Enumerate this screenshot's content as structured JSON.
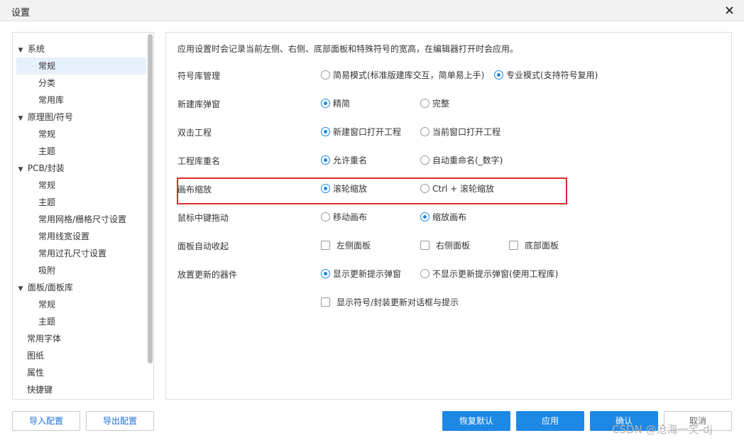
{
  "window": {
    "title": "设置"
  },
  "tree": {
    "items": [
      {
        "label": "系统",
        "expanded": true
      },
      {
        "label": "常规",
        "selected": true
      },
      {
        "label": "分类"
      },
      {
        "label": "常用库"
      },
      {
        "label": "原理图/符号",
        "expanded": true
      },
      {
        "label": "常规"
      },
      {
        "label": "主题"
      },
      {
        "label": "PCB/封装",
        "expanded": true
      },
      {
        "label": "常规"
      },
      {
        "label": "主题"
      },
      {
        "label": "常用网格/栅格尺寸设置"
      },
      {
        "label": "常用线宽设置"
      },
      {
        "label": "常用过孔尺寸设置"
      },
      {
        "label": "吸附"
      },
      {
        "label": "面板/面板库",
        "expanded": true
      },
      {
        "label": "常规"
      },
      {
        "label": "主题"
      },
      {
        "label": "常用字体"
      },
      {
        "label": "图纸"
      },
      {
        "label": "属性"
      },
      {
        "label": "快捷键"
      }
    ]
  },
  "main": {
    "note": "应用设置时会记录当前左侧、右侧、底部面板和特殊符号的宽高，在编辑器打开时会应用。",
    "rows": [
      {
        "label": "符号库管理",
        "options": [
          {
            "label": "简易模式(标准版建库交互，简单易上手)",
            "checked": false
          },
          {
            "label": "专业模式(支持符号复用)",
            "checked": true
          }
        ]
      },
      {
        "label": "新建库弹窗",
        "options": [
          {
            "label": "精简",
            "checked": true
          },
          {
            "label": "完整",
            "checked": false
          }
        ]
      },
      {
        "label": "双击工程",
        "options": [
          {
            "label": "新建窗口打开工程",
            "checked": true
          },
          {
            "label": "当前窗口打开工程",
            "checked": false
          }
        ]
      },
      {
        "label": "工程库重名",
        "options": [
          {
            "label": "允许重名",
            "checked": true
          },
          {
            "label": "自动重命名(_数字)",
            "checked": false
          }
        ]
      },
      {
        "label": "画布缩放",
        "options": [
          {
            "label": "滚轮缩放",
            "checked": true
          },
          {
            "label": "Ctrl + 滚轮缩放",
            "checked": false
          }
        ]
      },
      {
        "label": "鼠标中键拖动",
        "options": [
          {
            "label": "移动画布",
            "checked": false
          },
          {
            "label": "缩放画布",
            "checked": true
          }
        ]
      },
      {
        "label": "面板自动收起",
        "checkboxes": [
          {
            "label": "左侧面板",
            "checked": false
          },
          {
            "label": "右侧面板",
            "checked": false
          },
          {
            "label": "底部面板",
            "checked": false
          }
        ]
      },
      {
        "label": "放置更新的器件",
        "options": [
          {
            "label": "显示更新提示弹窗",
            "checked": true
          },
          {
            "label": "不显示更新提示弹窗(使用工程库)",
            "checked": false
          }
        ]
      }
    ],
    "extra_checkbox": {
      "label": "显示符号/封装更新对话框与提示",
      "checked": false
    }
  },
  "buttons": {
    "import": "导入配置",
    "export": "导出配置",
    "reset": "恢复默认",
    "apply": "应用",
    "ok": "确认",
    "cancel": "取消"
  },
  "watermark": "CSDN @沧海一笑-dj",
  "colors": {
    "accent": "#1e88e5",
    "highlight": "#e02b2b",
    "selected_bg": "#e6f1fb"
  }
}
